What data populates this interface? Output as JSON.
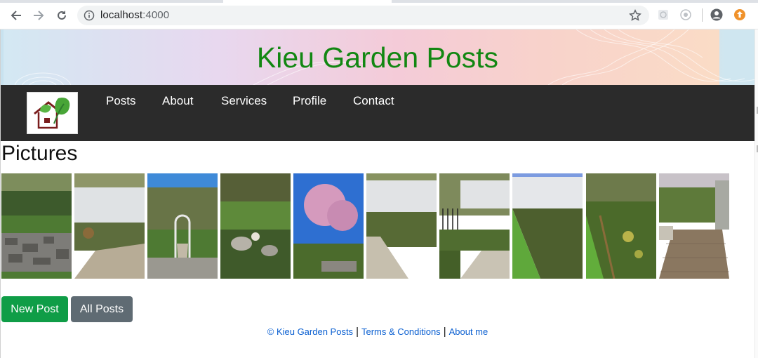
{
  "browser": {
    "url_host": "localhost",
    "url_port": ":4000",
    "icons": [
      "back-arrow-icon",
      "forward-arrow-icon",
      "reload-icon",
      "info-icon",
      "star-icon",
      "extension-icon",
      "profile-icon",
      "update-icon"
    ]
  },
  "site": {
    "title": "Kieu Garden Posts",
    "brand_color": "#128712"
  },
  "nav": {
    "items": [
      {
        "label": "Posts"
      },
      {
        "label": "About"
      },
      {
        "label": "Services"
      },
      {
        "label": "Profile"
      },
      {
        "label": "Contact"
      }
    ]
  },
  "gallery": {
    "heading": "Pictures",
    "photos": [
      {
        "name": "photo-stone-wall"
      },
      {
        "name": "photo-fence-walkway"
      },
      {
        "name": "photo-arch-path"
      },
      {
        "name": "photo-rock-garden"
      },
      {
        "name": "photo-cherry-tree"
      },
      {
        "name": "photo-fence-bed"
      },
      {
        "name": "photo-iron-fence"
      },
      {
        "name": "photo-lawn-bed"
      },
      {
        "name": "photo-flower-border"
      },
      {
        "name": "photo-brick-patio"
      }
    ]
  },
  "actions": {
    "new_post": "New Post",
    "all_posts": "All Posts"
  },
  "footer": {
    "copyright": "© Kieu Garden Posts",
    "separator": "|",
    "terms": "Terms & Conditions",
    "about": "About me"
  },
  "colors": {
    "navbar": "#2b2b2b",
    "new_post": "#0f9d47",
    "all_posts": "#5f6b73",
    "link": "#0a5fd1"
  }
}
